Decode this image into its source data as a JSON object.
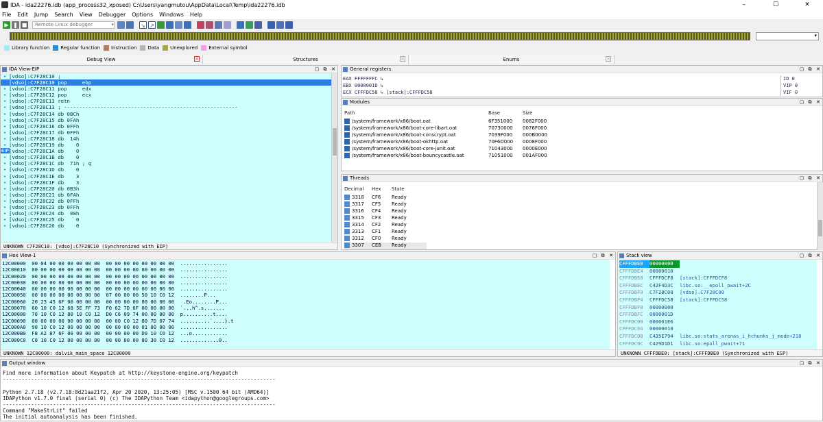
{
  "window": {
    "title": "IDA - ida22276.idb (app_process32_xposed) C:\\Users\\yangmutou\\AppData\\Local\\Temp\\ida22276.idb",
    "minimize": "–",
    "maximize": "☐",
    "close": "✕"
  },
  "menu": [
    "File",
    "Edit",
    "Jump",
    "Search",
    "View",
    "Debugger",
    "Options",
    "Windows",
    "Help"
  ],
  "toolbar": {
    "debugger_select": "Remote Linux debugger"
  },
  "legend": [
    {
      "label": "Library function",
      "color": "#a8e8ee"
    },
    {
      "label": "Regular function",
      "color": "#2d8fd4"
    },
    {
      "label": "Instruction",
      "color": "#b07c5b"
    },
    {
      "label": "Data",
      "color": "#b6b6b6"
    },
    {
      "label": "Unexplored",
      "color": "#a7a74a"
    },
    {
      "label": "External symbol",
      "color": "#f0a0f0"
    }
  ],
  "tabs": [
    {
      "label": "Debug View"
    },
    {
      "label": "Structures"
    },
    {
      "label": "Enums"
    }
  ],
  "ida_view": {
    "title": "IDA View-EIP",
    "eip_marker": "EIP",
    "lines": [
      "[vdso]:C7F28C10 ;",
      "[vdso]:C7F28C10 pop     ebp",
      "[vdso]:C7F28C11 pop     edx",
      "[vdso]:C7F28C12 pop     ecx",
      "[vdso]:C7F28C13 retn",
      "[vdso]:C7F28C13 ; ---------------------------------------------------------",
      "[vdso]:C7F28C14 db 0BCh",
      "[vdso]:C7F28C15 db 0FAh",
      "[vdso]:C7F28C16 db 0FFh",
      "[vdso]:C7F28C17 db 0FFh",
      "[vdso]:C7F28C18 db  14h",
      "[vdso]:C7F28C19 db    0",
      "[vdso]:C7F28C1A db    0",
      "[vdso]:C7F28C1B db    0",
      "[vdso]:C7F28C1C db  71h ; q",
      "[vdso]:C7F28C1D db    0",
      "[vdso]:C7F28C1E db    3",
      "[vdso]:C7F28C1F db    3",
      "[vdso]:C7F28C20 db 0B3h",
      "[vdso]:C7F28C21 db 0FAh",
      "[vdso]:C7F28C22 db 0FFh",
      "[vdso]:C7F28C23 db 0FFh",
      "[vdso]:C7F28C24 db  08h",
      "[vdso]:C7F28C25 db    0",
      "[vdso]:C7F28C26 db    0"
    ],
    "status": "UNKNOWN C7F28C10: [vdso]:C7F28C10 (Synchronized with EIP)"
  },
  "registers": {
    "title": "General registers",
    "left": [
      "EAX FFFFFFFC ↳",
      "EBX 0000001D ↳",
      "ECX CFFFDC58 ↳ [stack]:CFFFDC58"
    ],
    "right": [
      "ID  0",
      "VIP 0",
      "VIF 0"
    ]
  },
  "modules": {
    "title": "Modules",
    "headers": [
      "Path",
      "Base",
      "Size"
    ],
    "rows": [
      [
        "/system/framework/x86/boot.oat",
        "6F351000",
        "0082F000"
      ],
      [
        "/system/framework/x86/boot-core-libart.oat",
        "70730000",
        "0076F000"
      ],
      [
        "/system/framework/x86/boot-conscrypt.oat",
        "7039F000",
        "000B0000"
      ],
      [
        "/system/framework/x86/boot-okhttp.oat",
        "70F6D000",
        "0008F000"
      ],
      [
        "/system/framework/x86/boot-core-junit.oat",
        "71043000",
        "0000E000"
      ],
      [
        "/system/framework/x86/boot-bouncycastle.oat",
        "71051000",
        "001AF000"
      ]
    ]
  },
  "threads": {
    "title": "Threads",
    "headers": [
      "Decimal",
      "Hex",
      "State"
    ],
    "rows": [
      [
        "3318",
        "CF6",
        "Ready"
      ],
      [
        "3317",
        "CF5",
        "Ready"
      ],
      [
        "3316",
        "CF4",
        "Ready"
      ],
      [
        "3315",
        "CF3",
        "Ready"
      ],
      [
        "3314",
        "CF2",
        "Ready"
      ],
      [
        "3313",
        "CF1",
        "Ready"
      ],
      [
        "3312",
        "CF0",
        "Ready"
      ],
      [
        "3307",
        "CEB",
        "Ready"
      ]
    ]
  },
  "hex_view": {
    "title": "Hex View-1",
    "lines": [
      "12C00000  00 04 00 00 00 00 00 00  00 00 00 00 00 00 00 00  ................",
      "12C00010  00 00 00 00 00 00 00 00  00 00 00 00 00 00 00 00  ................",
      "12C00020  00 00 00 00 00 00 00 00  00 00 00 00 00 00 00 00  ................",
      "12C00030  00 00 00 00 00 00 00 00  00 00 00 00 00 00 00 00  ................",
      "12C00040  00 00 00 00 00 00 00 00  00 00 00 00 00 00 00 00  ................",
      "12C00050  00 00 00 00 00 00 00 00  07 00 00 00 50 10 C0 12  ........P...",
      "12C00060  20 23 45 6F 00 00 00 00  00 00 00 00 00 00 00 00   .Eo........P...",
      "12C00070  60 10 C0 12 68 5E FF 73  F0 62 7D 6F 00 00 00 00  `...h^.s.......",
      "12C00080  70 10 C0 12 80 10 C0 12  D0 C6 09 74 00 00 00 00  p..........t....",
      "12C00090  00 00 00 00 00 00 00 00  00 00 C0 12 80 7D 07 74  ..........`....}.t",
      "12C000A0  90 10 C0 12 00 00 00 00  00 00 00 00 01 00 00 00  ................",
      "12C000B0  F8 A2 87 6F 00 00 00 00  00 00 00 00 D0 10 C0 12  ...o............",
      "12C000C0  C0 10 C0 12 00 00 00 00  00 00 00 00 80 30 C0 12  .............0.."
    ],
    "status": "UNKNOWN 12C00000: dalvik_main_space 12C00000"
  },
  "stack_view": {
    "title": "Stack view",
    "lines": [
      {
        "addr": "CFFFDBE0",
        "val": "00000000",
        "cmt": ""
      },
      {
        "addr": "CFFFDBE4",
        "val": "00000010",
        "cmt": ""
      },
      {
        "addr": "CFFFDBE8",
        "val": "CFFFDCF8",
        "cmt": "[stack]:CFFFDCF8"
      },
      {
        "addr": "CFFFDBEC",
        "val": "C42F4D3C",
        "cmt": "libc.so:__epoll_pwait+2C"
      },
      {
        "addr": "CFFFDBF0",
        "val": "C7F28C00",
        "cmt": "[vdso]:C7F28C00"
      },
      {
        "addr": "CFFFDBF4",
        "val": "CFFFDC58",
        "cmt": "[stack]:CFFFDC58"
      },
      {
        "addr": "CFFFDBF8",
        "val": "00000000",
        "cmt": ""
      },
      {
        "addr": "CFFFDBFC",
        "val": "0000001D",
        "cmt": ""
      },
      {
        "addr": "CFFFDC00",
        "val": "000001E6",
        "cmt": ""
      },
      {
        "addr": "CFFFDC04",
        "val": "00000010",
        "cmt": ""
      },
      {
        "addr": "CFFFDC08",
        "val": "C435E794",
        "cmt": "libc.so:stats_arenas_i_hchunks_j_mode+218"
      },
      {
        "addr": "CFFFDC0C",
        "val": "C429D1D1",
        "cmt": "libc.so:epoll_pwait+71"
      }
    ],
    "status": "UNKNOWN CFFFDBE0: [stack]:CFFFDBE0 (Synchronized with ESP)"
  },
  "output": {
    "title": "Output window",
    "text": "Find more information about Keypatch at http://keystone-engine.org/keypatch\n---------------------------------------------------------------------------------------\n\nPython 2.7.18 (v2.7.18:8d21aa21f2, Apr 20 2020, 13:25:05) [MSC v.1500 64 bit (AMD64)]\nIDAPython v1.7.0 final (serial 0) (c) The IDAPython Team <idapython@googlegroups.com>\n---------------------------------------------------------------------------------------\nCommand \"MakeStrLit\" failed\nThe initial autoanalysis has been finished."
  }
}
